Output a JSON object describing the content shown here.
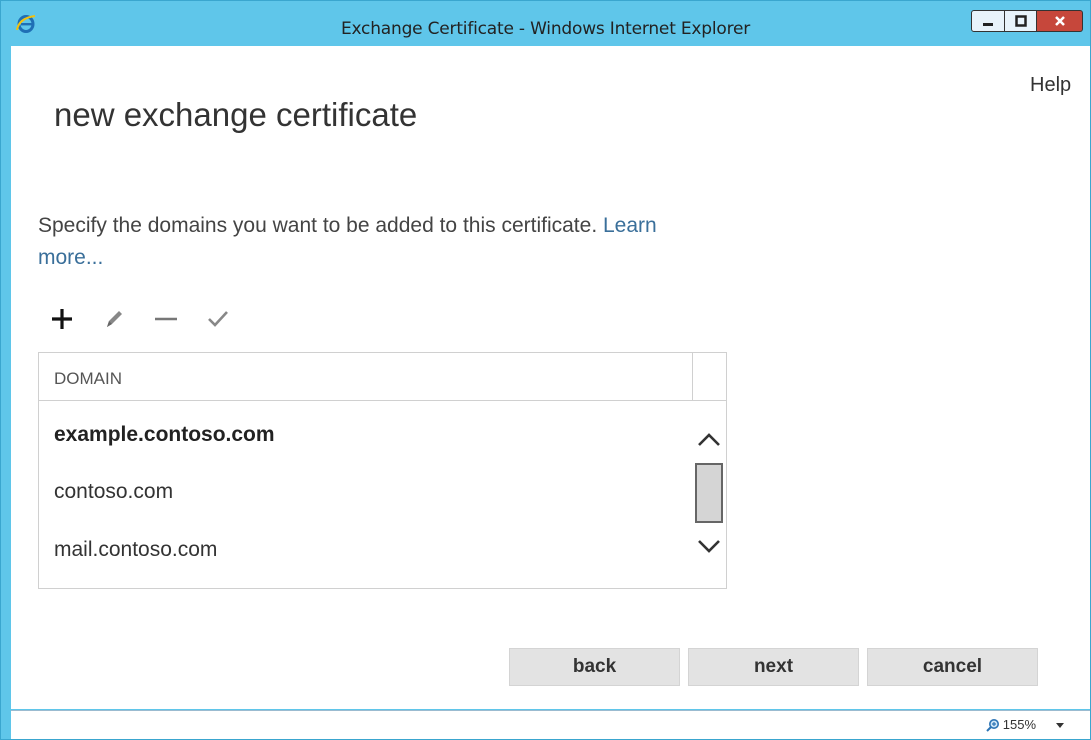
{
  "window": {
    "title": "Exchange Certificate - Windows Internet Explorer"
  },
  "header": {
    "help_label": "Help"
  },
  "page": {
    "title": "new exchange certificate",
    "description": "Specify the domains you want to be added to this certificate.",
    "learn_more": "Learn more..."
  },
  "toolbar": {
    "icons": [
      "add-icon",
      "edit-icon",
      "remove-icon",
      "checkmark-icon"
    ]
  },
  "grid": {
    "column_header": "DOMAIN",
    "rows": [
      "example.contoso.com",
      "contoso.com",
      "mail.contoso.com"
    ],
    "selected_index": 0
  },
  "buttons": {
    "back": "back",
    "next": "next",
    "cancel": "cancel"
  },
  "status": {
    "zoom": "155%"
  },
  "colors": {
    "titlebar": "#5fc6ea",
    "close_button": "#c6473b",
    "link": "#3a6f9a"
  }
}
